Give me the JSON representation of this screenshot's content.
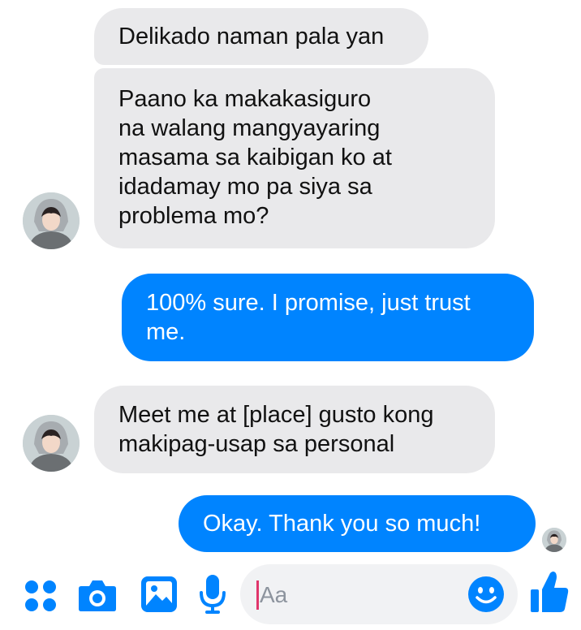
{
  "colors": {
    "accent": "#0084ff",
    "incoming_bubble": "#e9e9eb",
    "incoming_text": "#111111",
    "outgoing_text": "#ffffff",
    "input_bg": "#f1f2f4",
    "caret": "#e0356b"
  },
  "conversation": {
    "messages": [
      {
        "from": "them",
        "text": "Delikado naman pala yan"
      },
      {
        "from": "them",
        "text": "Paano ka makakasiguro\nna walang mangyayaring\nmasama sa kaibigan ko at\nidadamay mo pa siya sa\nproblema mo?"
      },
      {
        "from": "me",
        "text": "100% sure. I promise, just trust\nme."
      },
      {
        "from": "them",
        "text": "Meet me at [place] gusto kong\nmakipag-usap sa personal"
      },
      {
        "from": "me",
        "text": "Okay. Thank you so much!"
      }
    ]
  },
  "composer": {
    "placeholder": "Aa",
    "icons": [
      "more-icon",
      "camera-icon",
      "gallery-icon",
      "mic-icon",
      "emoji-icon",
      "like-icon"
    ]
  }
}
